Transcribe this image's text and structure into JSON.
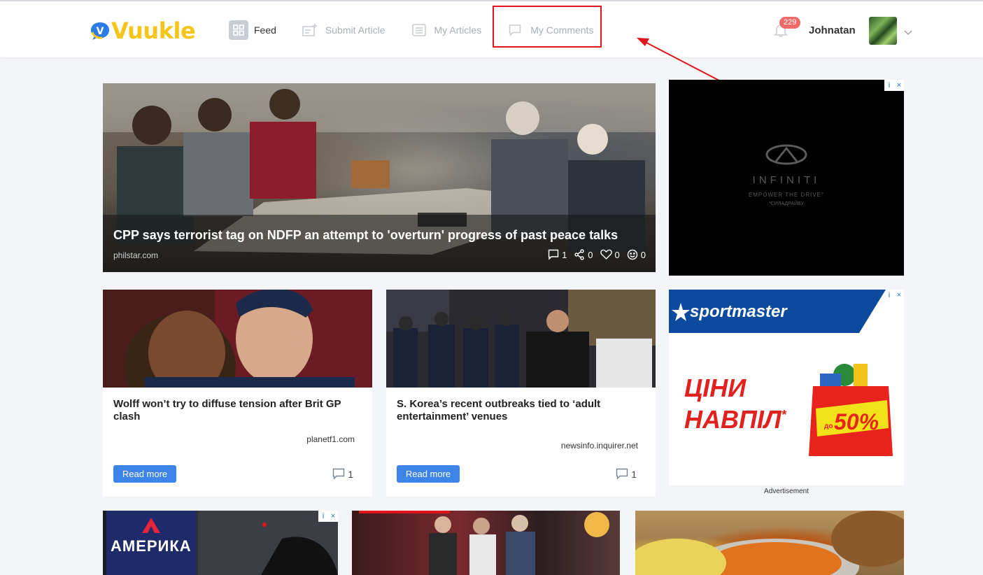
{
  "brand": {
    "name": "Vuukle",
    "letter": "V"
  },
  "nav": [
    {
      "label": "Feed",
      "icon": "grid-icon",
      "active": true
    },
    {
      "label": "Submit Article",
      "icon": "submit-article-icon",
      "active": false
    },
    {
      "label": "My Articles",
      "icon": "list-icon",
      "active": false
    },
    {
      "label": "My Comments",
      "icon": "comment-icon",
      "active": false
    }
  ],
  "user": {
    "notifications": "229",
    "name": "Johnatan"
  },
  "hero": {
    "title": "CPP says terrorist tag on NDFP an attempt to 'overturn' progress of past peace talks",
    "source": "philstar.com",
    "comments": "1",
    "shares": "0",
    "likes": "0",
    "reactions": "0"
  },
  "cards": [
    {
      "title": "Wolff won’t try to diffuse tension after Brit GP clash",
      "source": "planetf1.com",
      "read_more": "Read more",
      "comments": "1"
    },
    {
      "title": "S. Korea’s recent outbreaks tied to ‘adult entertainment’ venues",
      "source": "newsinfo.inquirer.net",
      "read_more": "Read more",
      "comments": "1"
    }
  ],
  "ads": {
    "infiniti": {
      "name": "INFINITI",
      "tagline": "EMPOWER THE DRIVE°",
      "sub": "*СИЛАДРАЙВУ"
    },
    "sportmaster": {
      "logo": "sportmaster",
      "line1": "ЦІНИ",
      "line2": "НАВПІЛ",
      "star": "*",
      "prefix": "до",
      "discount": "50%"
    },
    "caption": "Advertisement",
    "amerika": {
      "name": "АМЕРИКА"
    },
    "choice_info": "i",
    "choice_close": "×"
  },
  "colors": {
    "accent": "#3d84e8",
    "brand": "#f5c518",
    "highlight": "#e0141b",
    "badge": "#f06a6a"
  }
}
